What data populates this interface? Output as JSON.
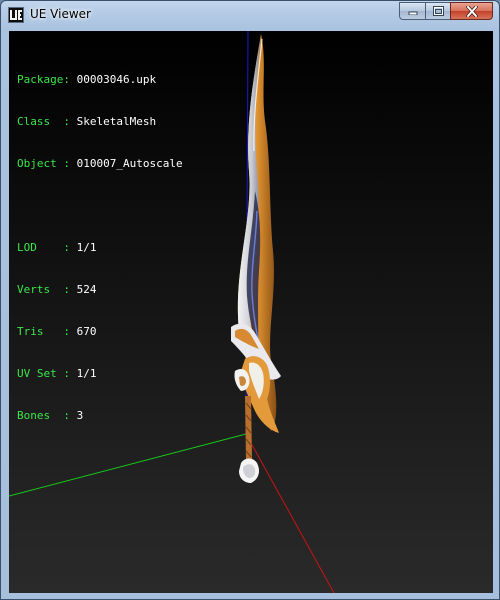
{
  "window": {
    "title": "UE Viewer"
  },
  "info": {
    "object_rows": [
      {
        "label": "Package: ",
        "value": "00003046.upk"
      },
      {
        "label": "Class  : ",
        "value": "SkeletalMesh"
      },
      {
        "label": "Object : ",
        "value": "010007_Autoscale"
      }
    ],
    "mesh_rows": [
      {
        "label": "LOD    : ",
        "value": "1/1"
      },
      {
        "label": "Verts  : ",
        "value": "524"
      },
      {
        "label": "Tris   : ",
        "value": "670"
      },
      {
        "label": "UV Set : ",
        "value": "1/1"
      },
      {
        "label": "Bones  : ",
        "value": "3"
      }
    ]
  },
  "colors": {
    "label_green": "#3ce64a",
    "value_white": "#ffffff",
    "axis_x": "#cc1414",
    "axis_y": "#14cc14",
    "axis_z": "#1414cc"
  },
  "icons": [
    "app-icon",
    "minimize-icon",
    "maximize-icon",
    "close-icon"
  ]
}
